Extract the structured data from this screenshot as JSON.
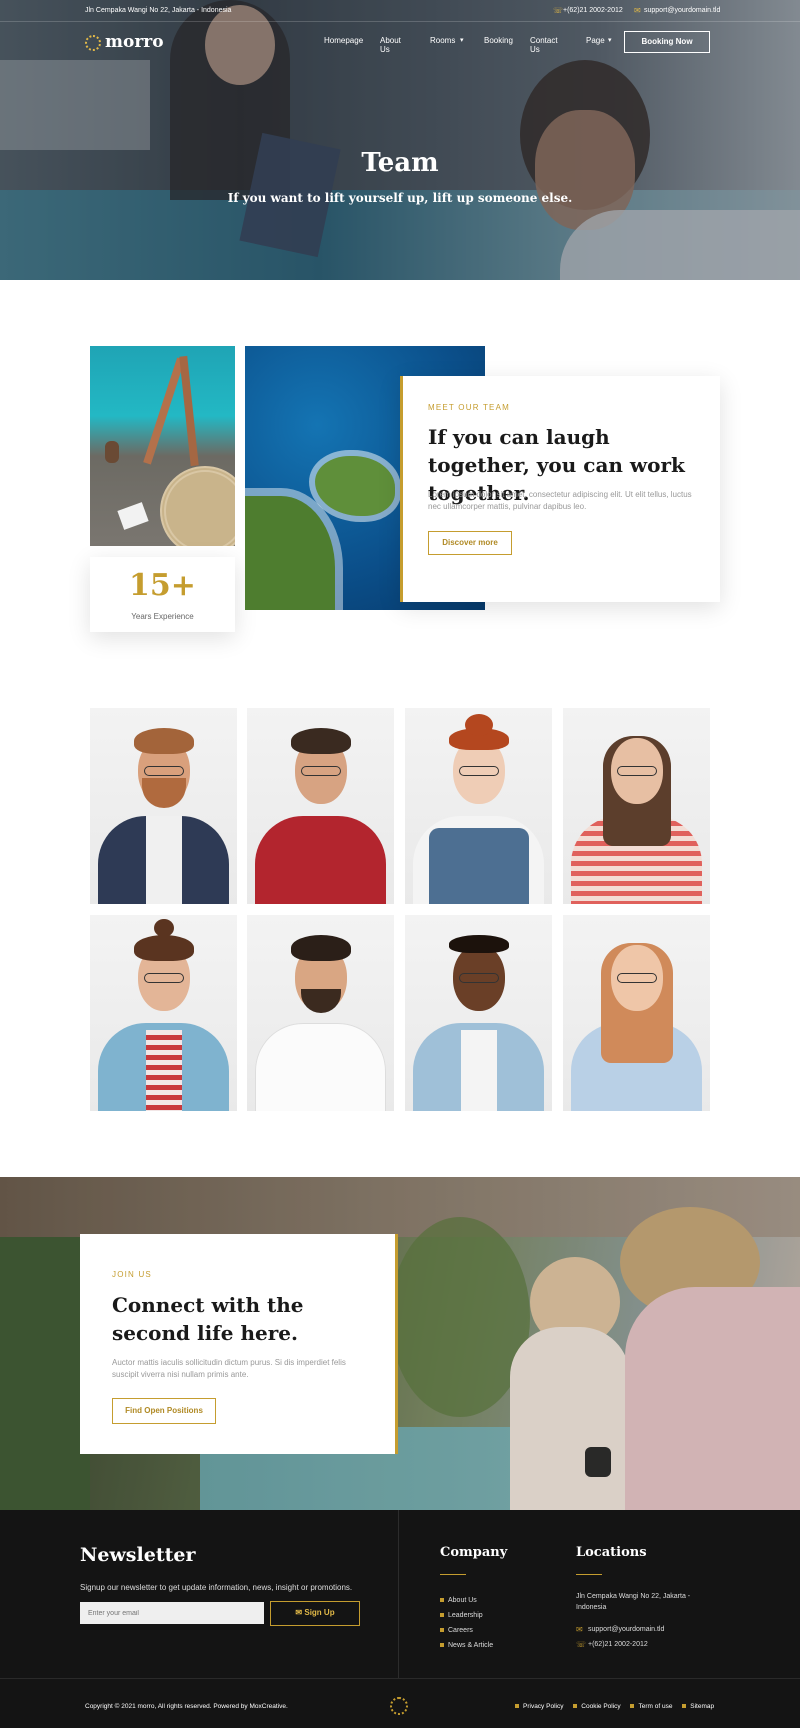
{
  "topbar": {
    "address": "Jln Cempaka Wangi No 22, Jakarta - Indonesia",
    "phone": "+(62)21 2002-2012",
    "email": "support@yourdomain.tld"
  },
  "nav": {
    "logo": "morro",
    "items": [
      "Homepage",
      "About Us",
      "Rooms",
      "Booking",
      "Contact Us",
      "Page"
    ],
    "cta": "Booking Now"
  },
  "hero": {
    "title": "Team",
    "subtitle": "If you want to lift yourself up, lift up someone else."
  },
  "about": {
    "years_value": "15+",
    "years_label": "Years Experience",
    "eyebrow": "MEET OUR TEAM",
    "heading": "If you can laugh together, you can work together.",
    "text": "Lorem ipsum dolor sit amet, consectetur adipiscing elit. Ut elit tellus, luctus nec ullamcorper mattis, pulvinar dapibus leo.",
    "button": "Discover more"
  },
  "join": {
    "eyebrow": "JOIN US",
    "heading": "Connect with the second life here.",
    "text": "Auctor mattis iaculis sollicitudin dictum purus. Si dis imperdiet felis suscipit viverra nisi nullam primis ante.",
    "button": "Find Open Positions"
  },
  "footer": {
    "newsletter_title": "Newsletter",
    "newsletter_text": "Signup our newsletter to get update information, news, insight or promotions.",
    "email_placeholder": "Enter your email",
    "signup": "Sign Up",
    "company_title": "Company",
    "company_links": [
      "About Us",
      "Leadership",
      "Careers",
      "News & Article"
    ],
    "locations_title": "Locations",
    "address": "Jln Cempaka Wangi No 22, Jakarta - Indonesia",
    "email": "support@yourdomain.tld",
    "phone": "+(62)21 2002-2012",
    "copyright": "Copyright © 2021 morro, All rights reserved. Powered by MoxCreative.",
    "legal_links": [
      "Privacy Policy",
      "Cookie Policy",
      "Term of use",
      "Sitemap"
    ]
  },
  "colors": {
    "accent": "#c59d2f",
    "dark": "#141414"
  }
}
